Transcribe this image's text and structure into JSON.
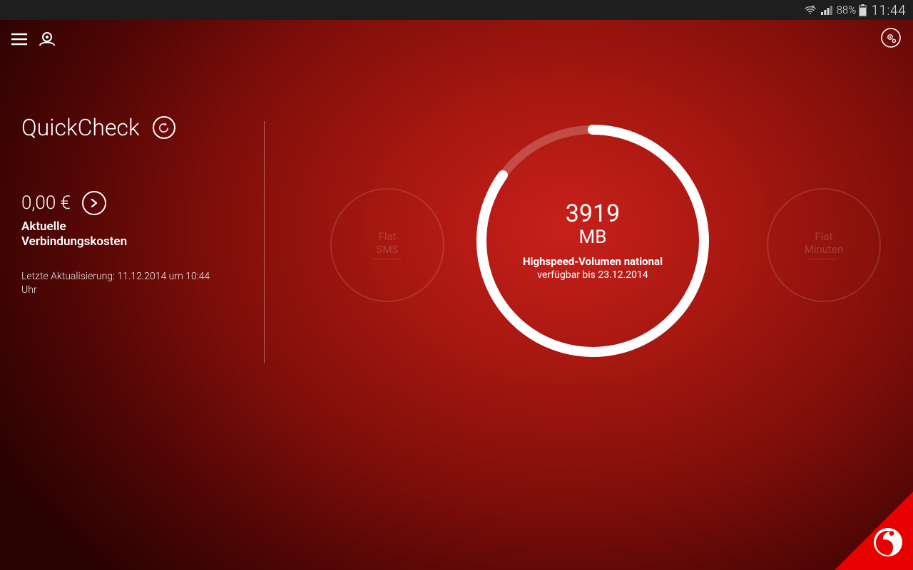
{
  "statusbar": {
    "battery_pct": "88%",
    "clock": "11:44"
  },
  "page": {
    "title": "QuickCheck"
  },
  "cost": {
    "value": "0,00 €",
    "label_line1": "Aktuelle",
    "label_line2": "Verbindungskosten"
  },
  "last_update": {
    "prefix": "Letzte Aktualisierung: ",
    "value": "11.12.2014 um 10:44",
    "suffix": "Uhr"
  },
  "circles": {
    "left": {
      "line1": "Flat",
      "line2": "SMS"
    },
    "right": {
      "line1": "Flat",
      "line2": "Minuten"
    },
    "main": {
      "value": "3919",
      "unit": "MB",
      "desc1": "Highspeed-Volumen national",
      "desc2": "verfügbar bis 23.12.2014",
      "progress_pct": 85
    }
  }
}
